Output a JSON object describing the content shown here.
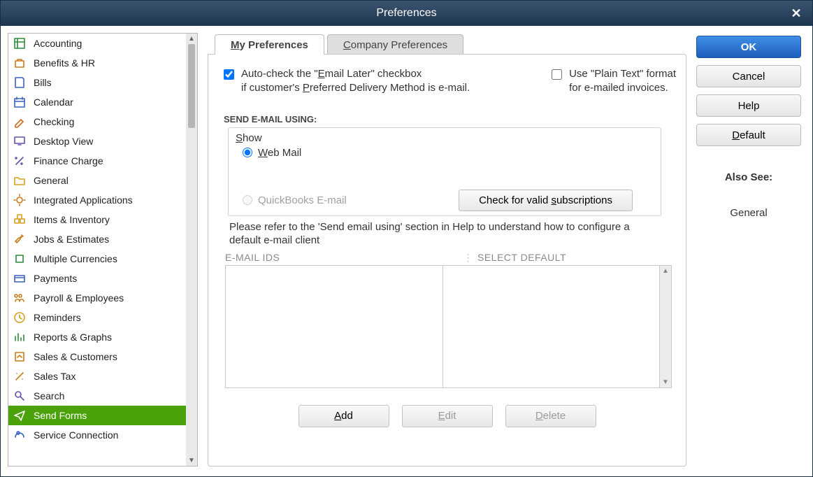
{
  "title": "Preferences",
  "sidebar": {
    "items": [
      {
        "label": "Accounting",
        "icon": "ledger"
      },
      {
        "label": "Benefits & HR",
        "icon": "briefcase"
      },
      {
        "label": "Bills",
        "icon": "bill"
      },
      {
        "label": "Calendar",
        "icon": "calendar"
      },
      {
        "label": "Checking",
        "icon": "pen"
      },
      {
        "label": "Desktop View",
        "icon": "desktop"
      },
      {
        "label": "Finance Charge",
        "icon": "percent"
      },
      {
        "label": "General",
        "icon": "folder"
      },
      {
        "label": "Integrated Applications",
        "icon": "gear"
      },
      {
        "label": "Items & Inventory",
        "icon": "boxes"
      },
      {
        "label": "Jobs & Estimates",
        "icon": "wrench"
      },
      {
        "label": "Multiple Currencies",
        "icon": "currency"
      },
      {
        "label": "Payments",
        "icon": "card"
      },
      {
        "label": "Payroll & Employees",
        "icon": "people"
      },
      {
        "label": "Reminders",
        "icon": "clock"
      },
      {
        "label": "Reports & Graphs",
        "icon": "chart"
      },
      {
        "label": "Sales & Customers",
        "icon": "sales"
      },
      {
        "label": "Sales Tax",
        "icon": "tax"
      },
      {
        "label": "Search",
        "icon": "search"
      },
      {
        "label": "Send Forms",
        "icon": "send",
        "selected": true
      },
      {
        "label": "Service Connection",
        "icon": "service"
      }
    ]
  },
  "tabs": {
    "my_label_pre": "M",
    "my_label_rest": "y Preferences",
    "company_pre": "C",
    "company_rest": "ompany Preferences"
  },
  "checks": {
    "autocheck_line1_pre": "Auto-check the \"",
    "autocheck_line1_u": "E",
    "autocheck_line1_post": "mail Later\" checkbox",
    "autocheck_line2_pre": "if customer's ",
    "autocheck_line2_u": "P",
    "autocheck_line2_post": "referred Delivery Method is e-mail.",
    "plaintext_line1": "Use \"Plain Text\" format",
    "plaintext_line2": "for e-mailed invoices."
  },
  "send_heading": "SEND E-MAIL USING:",
  "show_u": "S",
  "show_rest": "how",
  "radio_web_u": "W",
  "radio_web_rest": "eb Mail",
  "radio_qb": "QuickBooks E-mail",
  "check_sub_pre": "Check for valid ",
  "check_sub_u": "s",
  "check_sub_post": "ubscriptions",
  "help_note": "Please refer to the 'Send email using' section in Help to understand how to configure a default e-mail client",
  "grid": {
    "col1": "E-MAIL IDS",
    "col2": "SELECT DEFAULT"
  },
  "actions": {
    "add_u": "A",
    "add_rest": "dd",
    "edit_u": "E",
    "edit_rest": "dit",
    "delete_u": "D",
    "delete_rest": "elete"
  },
  "right": {
    "ok": "OK",
    "cancel": "Cancel",
    "help": "Help",
    "default_u": "D",
    "default_rest": "efault",
    "also_see": "Also See:",
    "general": "General"
  }
}
